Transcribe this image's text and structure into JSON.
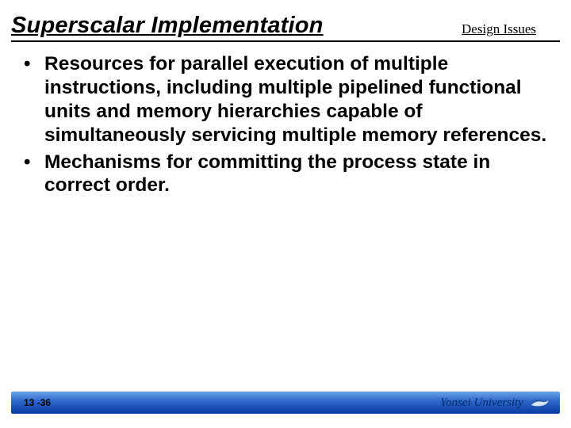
{
  "header": {
    "title": "Superscalar Implementation",
    "subtitle": "Design Issues"
  },
  "bullets": [
    "Resources for parallel execution of multiple instructions, including multiple pipelined functional units and memory hierarchies capable of simultaneously servicing multiple memory references.",
    "Mechanisms for committing the process state in correct order."
  ],
  "footer": {
    "page": "13 -36",
    "affiliation": "Yonsei University"
  }
}
